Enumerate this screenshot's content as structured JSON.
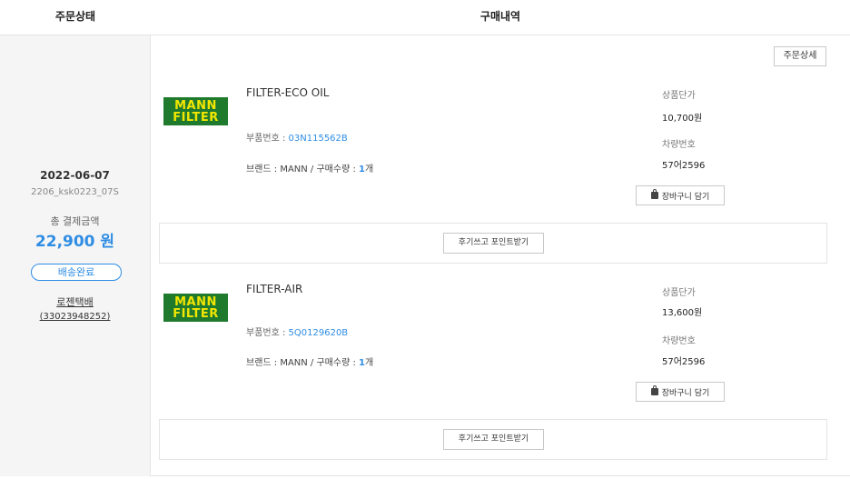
{
  "header": {
    "status_title": "주문상태",
    "history_title": "구매내역"
  },
  "order": {
    "date": "2022-06-07",
    "order_no": "2206_ksk0223_07S",
    "total_label": "총 결제금액",
    "total_amount": "22,900 원",
    "status": "배송완료",
    "courier": "로젠택배",
    "tracking": "(33023948252)"
  },
  "detail_button": "주문상세",
  "products": [
    {
      "logo_line1": "MANN",
      "logo_line2": "FILTER",
      "name": "FILTER-ECO OIL",
      "part_label": "부품번호 : ",
      "part_no": "03N115562B",
      "brand_prefix": "브랜드 : MANN / 구매수량 : ",
      "qty": "1",
      "qty_unit": "개",
      "price_label": "상품단가",
      "price": "10,700원",
      "car_label": "차량번호",
      "car_no": "57어2596",
      "cart_button": "장바구니 담기",
      "review_button": "후기쓰고 포인트받기"
    },
    {
      "logo_line1": "MANN",
      "logo_line2": "FILTER",
      "name": "FILTER-AIR",
      "part_label": "부품번호 : ",
      "part_no": "5Q0129620B",
      "brand_prefix": "브랜드 : MANN / 구매수량 : ",
      "qty": "1",
      "qty_unit": "개",
      "price_label": "상품단가",
      "price": "13,600원",
      "car_label": "차량번호",
      "car_no": "57어2596",
      "cart_button": "장바구니 담기",
      "review_button": "후기쓰고 포인트받기"
    }
  ],
  "colors": {
    "accent": "#2f8de4",
    "logo_bg": "#1f7a2e",
    "logo_text": "#f2e600",
    "panel_bg": "#f5f5f5"
  }
}
